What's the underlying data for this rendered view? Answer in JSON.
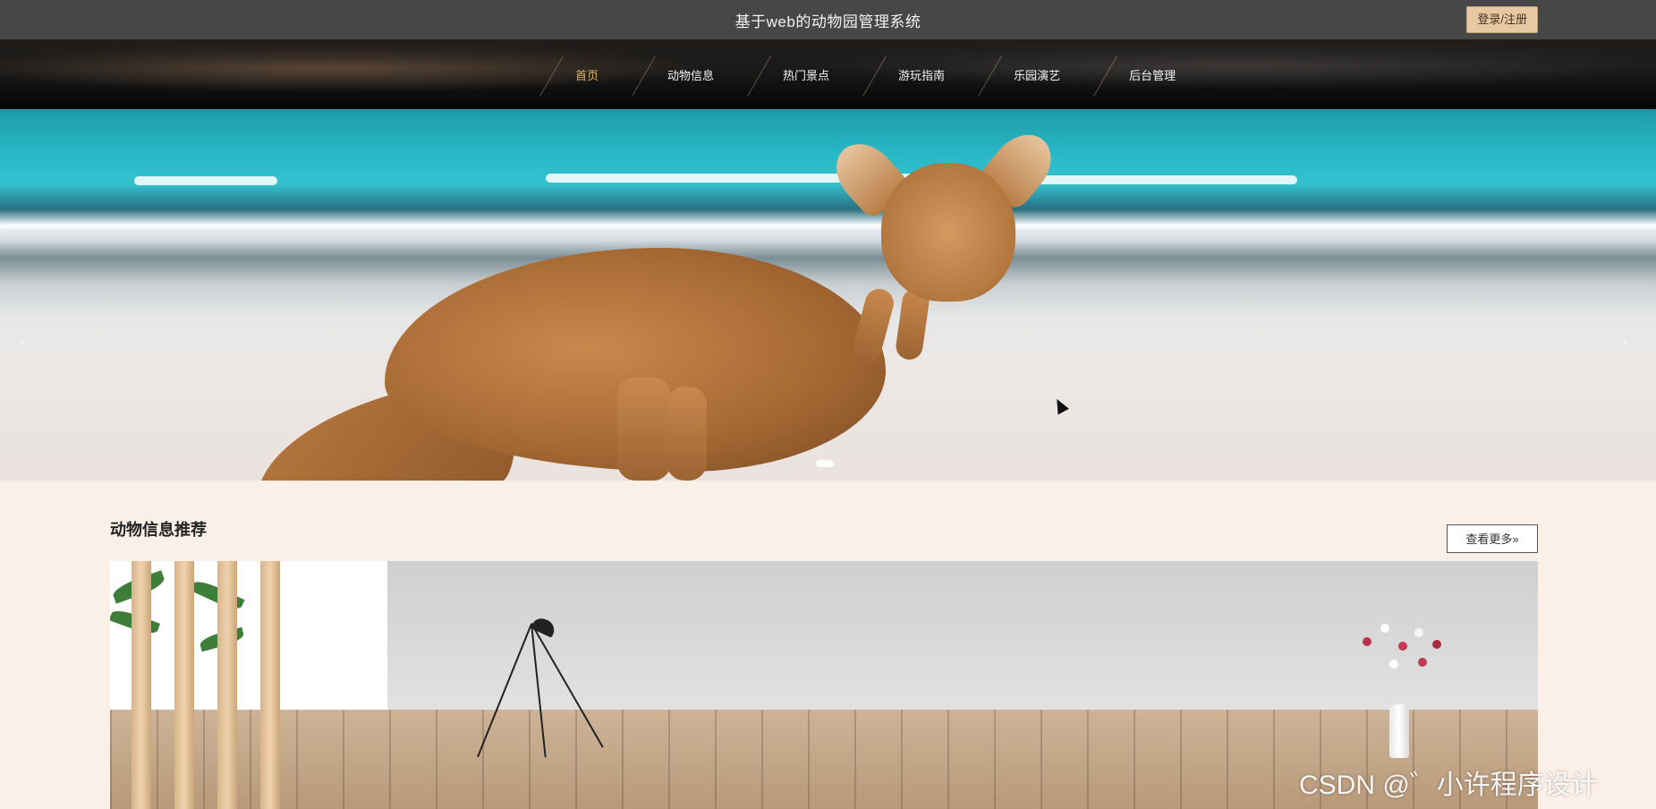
{
  "header": {
    "title": "基于web的动物园管理系统",
    "login_label": "登录/注册"
  },
  "nav": {
    "items": [
      {
        "label": "首页",
        "active": true
      },
      {
        "label": "动物信息",
        "active": false
      },
      {
        "label": "热门景点",
        "active": false
      },
      {
        "label": "游玩指南",
        "active": false
      },
      {
        "label": "乐园演艺",
        "active": false
      },
      {
        "label": "后台管理",
        "active": false
      }
    ]
  },
  "banner": {
    "prev_icon": "chevron-left-icon",
    "next_icon": "chevron-right-icon",
    "prev_glyph": "‹",
    "next_glyph": "›"
  },
  "section": {
    "title": "动物信息推荐",
    "more_label": "查看更多»"
  },
  "watermark": "CSDN @゛小许程序设计",
  "colors": {
    "topbar": "#474747",
    "accent": "#e0b272",
    "login_bg": "#e6c8a2",
    "page_bg": "#faf0e8"
  }
}
